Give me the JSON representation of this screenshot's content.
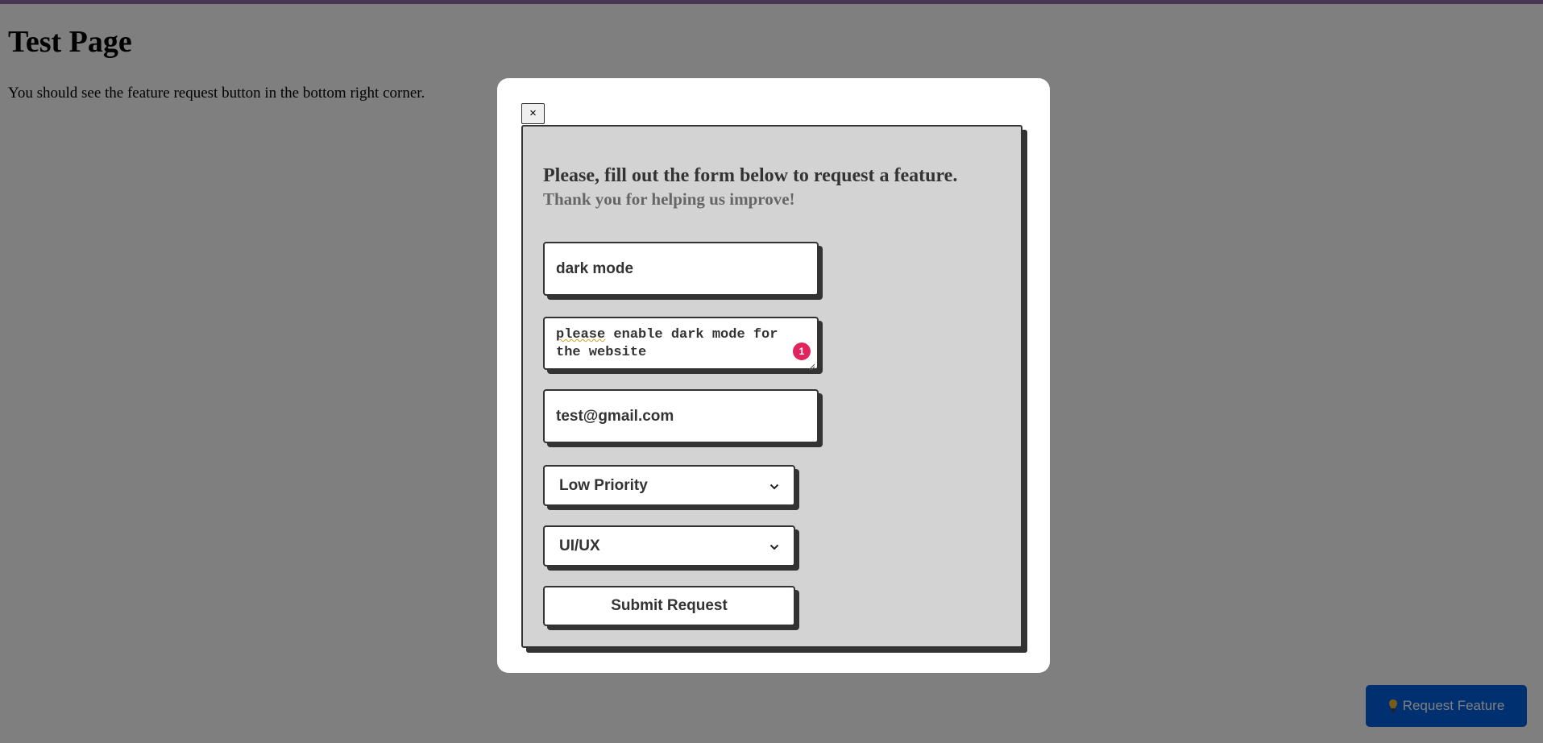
{
  "page": {
    "title": "Test Page",
    "description": "You should see the feature request button in the bottom right corner."
  },
  "launcher": {
    "label": "Request Feature",
    "icon": "lightbulb-icon"
  },
  "modal": {
    "close_label": "×",
    "heading": "Please, fill out the form below to request a feature.",
    "subheading": "Thank you for helping us improve!",
    "fields": {
      "title": "dark mode",
      "description": "please enable dark mode for the website",
      "description_first_word": "please",
      "description_rest": " enable dark mode for the website",
      "description_error_count": "1",
      "email": "test@gmail.com",
      "priority": "Low Priority",
      "category": "UI/UX"
    },
    "submit_label": "Submit Request"
  },
  "colors": {
    "launcher_bg": "#0060e0",
    "card_bg": "#d3d3d3",
    "error_badge": "#e0245e"
  }
}
